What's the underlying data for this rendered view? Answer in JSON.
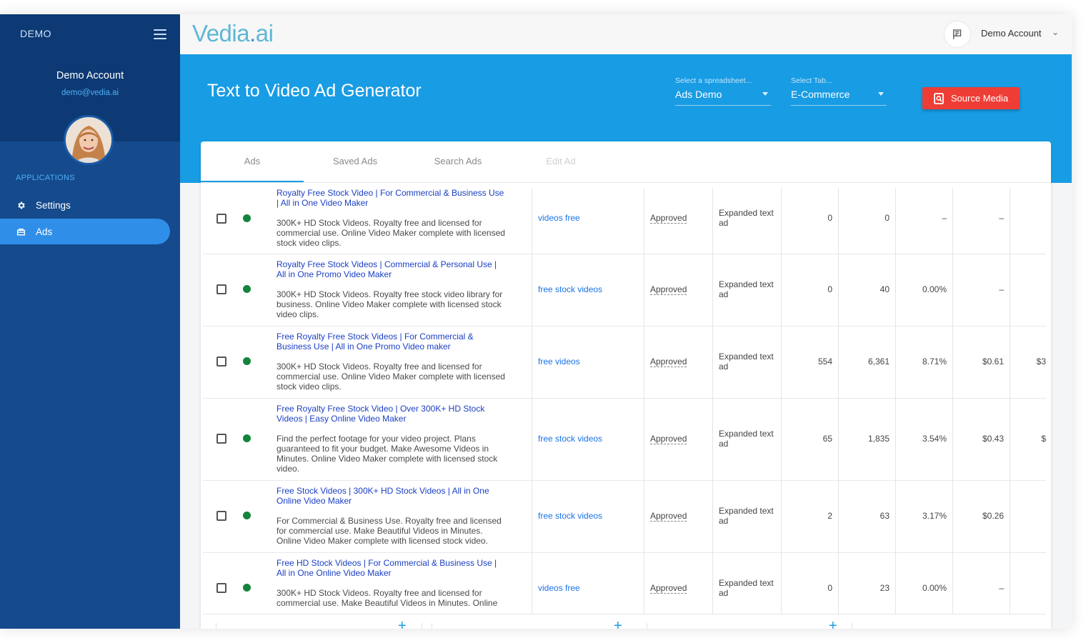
{
  "sidebar": {
    "brand": "DEMO",
    "user_name": "Demo Account",
    "user_email": "demo@vedia.ai",
    "section_label": "APPLICATIONS",
    "items": [
      {
        "label": "Settings",
        "icon": "gear-icon"
      },
      {
        "label": "Ads",
        "icon": "ads-icon",
        "active": true
      }
    ]
  },
  "topbar": {
    "logo_main": "Vedia",
    "logo_dot": ".",
    "logo_tld": "ai",
    "account_name": "Demo Account",
    "caret": "⌄"
  },
  "header": {
    "title": "Text to Video Ad Generator",
    "spreadsheet_label": "Select a spreadsheet...",
    "spreadsheet_value": "Ads Demo",
    "tab_label": "Select Tab...",
    "tab_value": "E-Commerce",
    "source_button": "Source Media"
  },
  "tabs": [
    {
      "label": "Ads",
      "active": true
    },
    {
      "label": "Saved Ads"
    },
    {
      "label": "Search Ads"
    },
    {
      "label": "Edit Ad",
      "disabled": true
    }
  ],
  "rows": [
    {
      "title": "Royalty Free Stock Video | For Commercial & Business Use | All in One Video Maker",
      "desc": "300K+ HD Stock Videos. Royalty free and licensed for commercial use. Online Video Maker complete with licensed stock video clips.",
      "keyword": "videos free",
      "status": "Approved",
      "type": "Expanded text ad",
      "c1": "0",
      "c2": "0",
      "c3": "–",
      "c4": "–",
      "c5": ""
    },
    {
      "title": "Royalty Free Stock Videos | Commercial & Personal Use | All in One Promo Video Maker",
      "desc": "300K+ HD Stock Videos. Royalty free stock video library for business. Online Video Maker complete with licensed stock video clips.",
      "keyword": "free stock videos",
      "status": "Approved",
      "type": "Expanded text ad",
      "c1": "0",
      "c2": "40",
      "c3": "0.00%",
      "c4": "–",
      "c5": ""
    },
    {
      "title": "Free Royalty Free Stock Videos | For Commercial & Business Use | All in One Promo Video maker",
      "desc": "300K+ HD Stock Videos. Royalty free and licensed for commercial use. Online Video Maker complete with licensed stock video clips.",
      "keyword": "free videos",
      "status": "Approved",
      "type": "Expanded text ad",
      "c1": "554",
      "c2": "6,361",
      "c3": "8.71%",
      "c4": "$0.61",
      "c5": "$3"
    },
    {
      "title": "Free Royalty Free Stock Video | Over 300K+ HD Stock Videos | Easy Online Video Maker",
      "desc": "Find the perfect footage for your video project. Plans guaranteed to fit your budget. Make Awesome Videos in Minutes. Online Video Maker complete with licensed stock video.",
      "keyword": "free stock videos",
      "status": "Approved",
      "type": "Expanded text ad",
      "c1": "65",
      "c2": "1,835",
      "c3": "3.54%",
      "c4": "$0.43",
      "c5": "$"
    },
    {
      "title": "Free Stock Videos | 300K+ HD Stock Videos | All in One Online Video Maker",
      "desc": "For Commercial & Business Use. Royalty free and licensed for commercial use. Make Beautiful Videos in Minutes. Online Video Maker complete with licensed stock video.",
      "keyword": "free stock videos",
      "status": "Approved",
      "type": "Expanded text ad",
      "c1": "2",
      "c2": "63",
      "c3": "3.17%",
      "c4": "$0.26",
      "c5": ""
    },
    {
      "title": "Free HD Stock Videos | For Commercial & Business Use | All in One Online Video Maker",
      "desc": "300K+ HD Stock Videos. Royalty free and licensed for commercial use. Make Beautiful Videos in Minutes. Online",
      "keyword": "videos free",
      "status": "Approved",
      "type": "Expanded text ad",
      "c1": "0",
      "c2": "23",
      "c3": "0.00%",
      "c4": "–",
      "c5": ""
    }
  ],
  "footer": {
    "plus": "+"
  },
  "colors": {
    "sidebar": "#154a8d",
    "sidebar_top": "#0d3a74",
    "accent": "#189ce4",
    "active_nav": "#2f8fe8",
    "danger": "#ee3d35",
    "status_ok": "#14843d",
    "link": "#1a3fc4"
  }
}
